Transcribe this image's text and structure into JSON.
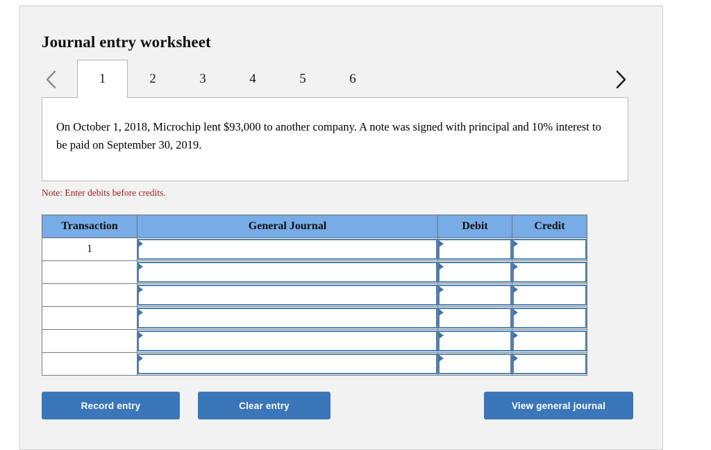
{
  "page": {
    "title": "Journal entry worksheet",
    "note": "Note: Enter debits before credits."
  },
  "tabs": {
    "prev_icon": "chevron-left-icon",
    "next_icon": "chevron-right-icon",
    "items": [
      {
        "label": "1",
        "active": true
      },
      {
        "label": "2",
        "active": false
      },
      {
        "label": "3",
        "active": false
      },
      {
        "label": "4",
        "active": false
      },
      {
        "label": "5",
        "active": false
      },
      {
        "label": "6",
        "active": false
      }
    ]
  },
  "scenario": {
    "text": "On October 1, 2018, Microchip lent $93,000 to another company. A note was signed with principal and 10% interest to be paid on September 30, 2019."
  },
  "table": {
    "headers": [
      "Transaction",
      "General Journal",
      "Debit",
      "Credit"
    ],
    "rows": [
      {
        "transaction": "1",
        "general_journal": "",
        "debit": "",
        "credit": ""
      },
      {
        "transaction": "",
        "general_journal": "",
        "debit": "",
        "credit": ""
      },
      {
        "transaction": "",
        "general_journal": "",
        "debit": "",
        "credit": ""
      },
      {
        "transaction": "",
        "general_journal": "",
        "debit": "",
        "credit": ""
      },
      {
        "transaction": "",
        "general_journal": "",
        "debit": "",
        "credit": ""
      },
      {
        "transaction": "",
        "general_journal": "",
        "debit": "",
        "credit": ""
      }
    ]
  },
  "buttons": {
    "record_entry": "Record entry",
    "clear_entry": "Clear entry",
    "view_general_journal": "View general journal"
  },
  "colors": {
    "header_blue": "#77ACE6",
    "button_blue": "#3A76B8",
    "field_border_blue": "#4A7FB5",
    "note_red": "#9B1B1B",
    "panel_gray": "#F2F2F2"
  }
}
